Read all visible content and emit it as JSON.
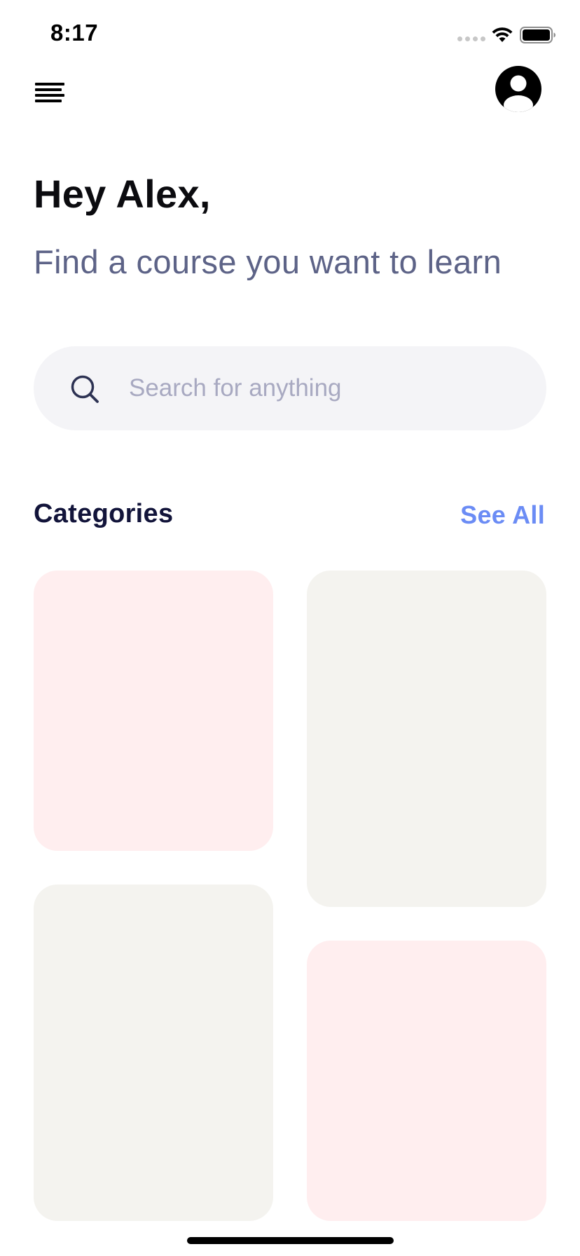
{
  "status_bar": {
    "time": "8:17",
    "icons": [
      "signal-icon",
      "wifi-icon",
      "battery-icon"
    ]
  },
  "header": {
    "menu_icon": "menu-icon",
    "profile_icon": "profile-icon"
  },
  "greeting": {
    "title": "Hey Alex,",
    "subtitle": "Find a course you want to learn"
  },
  "search": {
    "icon": "search-icon",
    "placeholder": "Search for anything",
    "value": ""
  },
  "categories": {
    "title": "Categories",
    "see_all_label": "See All",
    "cards": [
      {
        "color": "#ffeeef"
      },
      {
        "color": "#f4f3ef"
      },
      {
        "color": "#f4f3ef"
      },
      {
        "color": "#ffeeef"
      }
    ]
  },
  "colors": {
    "accent": "#6b8cf5",
    "subtitle": "#5d6387",
    "heading": "#12143a",
    "search_bg": "#f4f4f7",
    "card_pink": "#ffeeef",
    "card_beige": "#f4f3ef"
  }
}
